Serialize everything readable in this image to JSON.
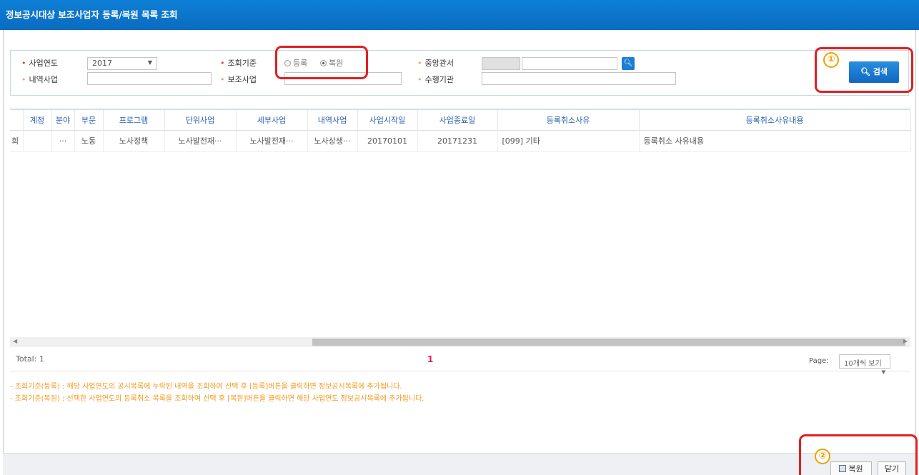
{
  "window": {
    "title": "정보공시대상 보조사업자 등록/복원 목록 조회"
  },
  "search": {
    "year_label": "사업연도",
    "year_value": "2017",
    "criteria_label": "조회기준",
    "criteria_options": [
      "등록",
      "복원"
    ],
    "criteria_selected": "복원",
    "ministry_label": "중앙관서",
    "sub_label": "내역사업",
    "subsidy_label": "보조사업",
    "agency_label": "수행기관",
    "search_button": "검색"
  },
  "table": {
    "columns": [
      "",
      "계정",
      "분야",
      "부문",
      "프로그램",
      "단위사업",
      "세부사업",
      "내역사업",
      "사업시작일",
      "사업종료일",
      "등록취소사유",
      "등록취소사유내용"
    ],
    "rows": [
      [
        "회",
        "",
        "···",
        "노동",
        "노사정책",
        "노사발전재···",
        "노사발전재···",
        "노사상생···",
        "20170101",
        "20171231",
        "[099] 기타",
        "등록취소 사유내용"
      ]
    ]
  },
  "footer": {
    "total": "Total: 1",
    "page_number": "1",
    "page_label": "Page:",
    "page_size": "10개씩 보기"
  },
  "notes": [
    "- 조회기준(등록) : 해당 사업연도의 공시목록에 누락된 내역을 조회하여 선택 후 [등록]버튼을 클릭하면 정보공시목록에 추가됩니다.",
    "- 조회기준(복원) : 선택한 사업연도의 등록취소 목록을 조회하여 선택 후 [복원]버튼을 클릭하면 해당 사업연도 정보공시목록에 추가됩니다."
  ],
  "actions": {
    "restore": "복원",
    "close": "닫기"
  },
  "annotations": {
    "marker1": "①",
    "marker2": "②"
  },
  "colors": {
    "header_blue": "#0e7fd6",
    "highlight_red": "#e02020",
    "note_orange": "#f39a1e",
    "page_pink": "#d81b60"
  }
}
